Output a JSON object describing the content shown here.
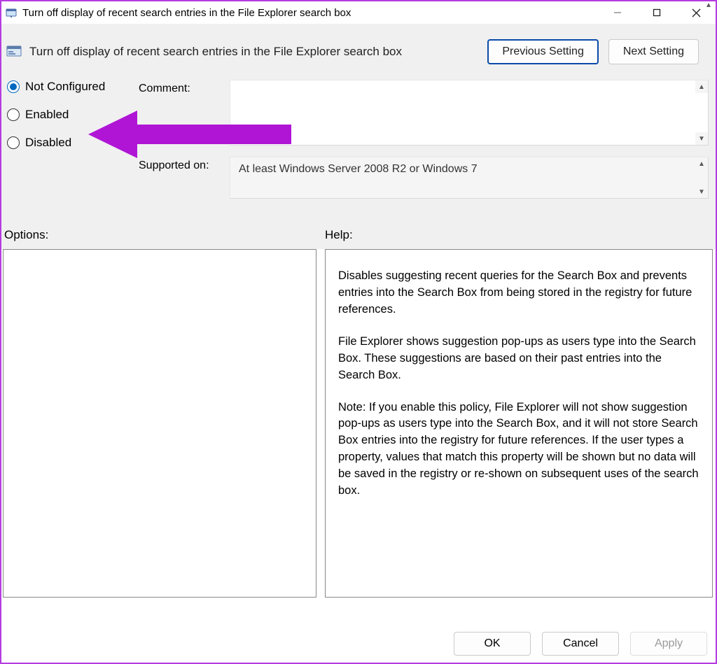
{
  "window": {
    "title": "Turn off display of recent search entries in the File Explorer search box"
  },
  "header": {
    "policy_title": "Turn off display of recent search entries in the File Explorer search box",
    "prev_button": "Previous Setting",
    "next_button": "Next Setting"
  },
  "state": {
    "options": [
      "Not Configured",
      "Enabled",
      "Disabled"
    ],
    "selected": "Not Configured"
  },
  "fields": {
    "comment_label": "Comment:",
    "comment_value": "",
    "supported_label": "Supported on:",
    "supported_value": "At least Windows Server 2008 R2 or Windows 7"
  },
  "sections": {
    "options_label": "Options:",
    "help_label": "Help:"
  },
  "help": {
    "p1": "Disables suggesting recent queries for the Search Box and prevents entries into the Search Box from being stored in the registry for future references.",
    "p2": "File Explorer shows suggestion pop-ups as users type into the Search Box.  These suggestions are based on their past entries into the Search Box.",
    "p3": "Note: If you enable this policy, File Explorer will not show suggestion pop-ups as users type into the Search Box, and it will not store Search Box entries into the registry for future references.  If the user types a property, values that match this property will be shown but no data will be saved in the registry or re-shown on subsequent uses of the search box."
  },
  "buttons": {
    "ok": "OK",
    "cancel": "Cancel",
    "apply": "Apply"
  },
  "annotation": {
    "color": "#b015d6"
  }
}
